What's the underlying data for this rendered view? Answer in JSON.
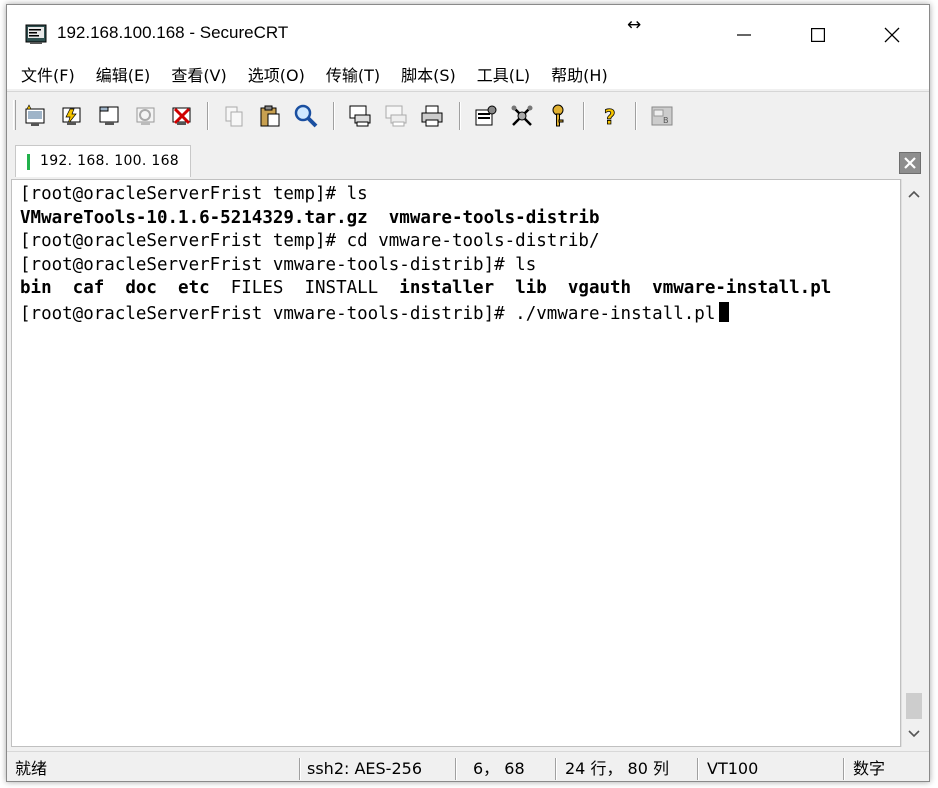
{
  "window": {
    "title": "192.168.100.168 - SecureCRT",
    "resize_glyph": "↔"
  },
  "menu": [
    "文件(F)",
    "编辑(E)",
    "查看(V)",
    "选项(O)",
    "传输(T)",
    "脚本(S)",
    "工具(L)",
    "帮助(H)"
  ],
  "toolbar": {
    "icons": [
      "connect-icon",
      "quick-connect-icon",
      "connect-in-tab-icon",
      "reconnect-icon",
      "disconnect-icon",
      "copy-icon",
      "paste-icon",
      "find-icon",
      "print-setup-icon",
      "print-selection-icon",
      "print-icon",
      "session-options-icon",
      "global-options-icon",
      "key-generation-icon",
      "help-icon",
      "sftp-icon"
    ]
  },
  "tab": {
    "label": "192. 168. 100. 168",
    "status_color": "#22b14c"
  },
  "terminal": {
    "lines": [
      [
        {
          "t": "[root@oracleServerFrist temp]# ls",
          "b": false
        }
      ],
      [
        {
          "t": "VMwareTools-10.1.6-5214329.tar.gz  vmware-tools-distrib",
          "b": true
        }
      ],
      [
        {
          "t": "[root@oracleServerFrist temp]# cd vmware-tools-distrib/",
          "b": false
        }
      ],
      [
        {
          "t": "[root@oracleServerFrist vmware-tools-distrib]# ls",
          "b": false
        }
      ],
      [
        {
          "t": "bin  caf  doc  etc  ",
          "b": true
        },
        {
          "t": "FILES  INSTALL  ",
          "b": false
        },
        {
          "t": "installer  lib  vgauth  vmware-install.pl",
          "b": true
        }
      ],
      [
        {
          "t": "[root@oracleServerFrist vmware-tools-distrib]# ./vmware-install.pl",
          "b": false
        }
      ]
    ]
  },
  "status": {
    "ready": "就绪",
    "cipher": "ssh2: AES-256",
    "cursor_pos": "6，  68",
    "dimensions": "24 行，  80 列",
    "emulation": "VT100",
    "numlock": "数字"
  }
}
